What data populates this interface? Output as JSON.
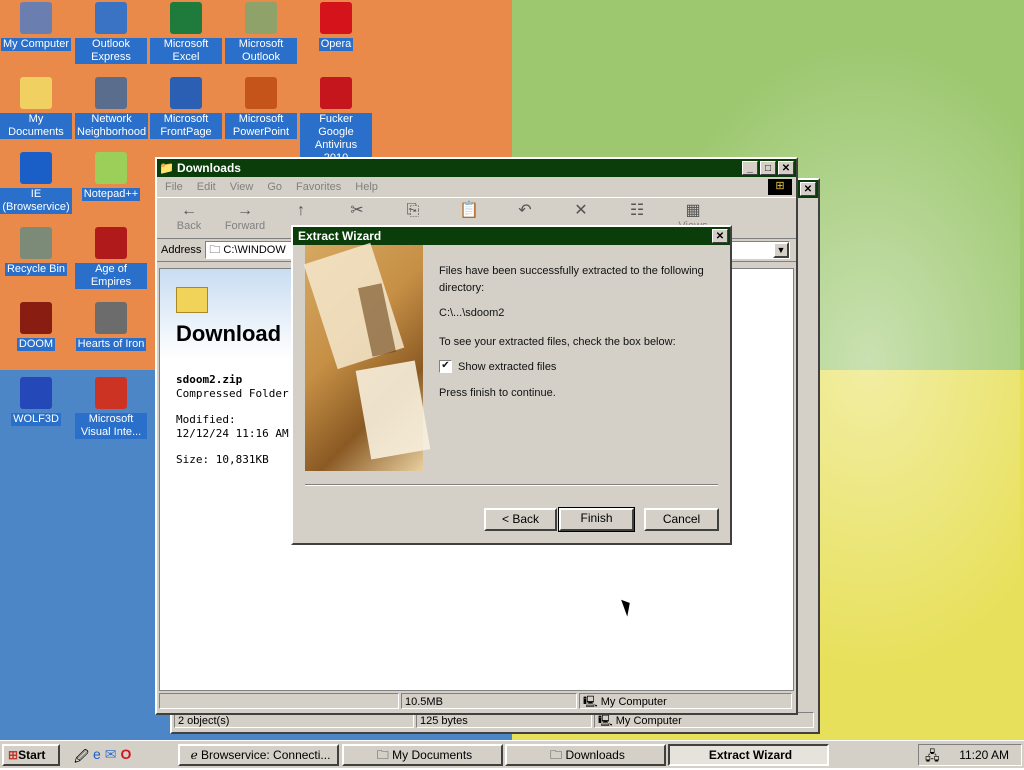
{
  "desktop": {
    "icons": [
      {
        "label": "My Computer",
        "icon": "my-computer-icon",
        "color": "#6a7fb0"
      },
      {
        "label": "Outlook Express",
        "icon": "outlook-express-icon",
        "color": "#3a72c4"
      },
      {
        "label": "Microsoft Excel",
        "icon": "excel-icon",
        "color": "#1e7b3b"
      },
      {
        "label": "Microsoft Outlook",
        "icon": "outlook-icon",
        "color": "#8fa26a"
      },
      {
        "label": "Opera",
        "icon": "opera-icon",
        "color": "#d4131b"
      },
      {
        "label": "My Documents",
        "icon": "my-documents-icon",
        "color": "#f0d060"
      },
      {
        "label": "Network Neighborhood",
        "icon": "network-neighborhood-icon",
        "color": "#5a6d8c"
      },
      {
        "label": "Microsoft FrontPage",
        "icon": "frontpage-icon",
        "color": "#2b5fb4"
      },
      {
        "label": "Microsoft PowerPoint",
        "icon": "powerpoint-icon",
        "color": "#c4541a"
      },
      {
        "label": "Fucker Google Antivirus 2010",
        "icon": "antivirus-icon",
        "color": "#c4161c"
      },
      {
        "label": "IE (Browservice)",
        "icon": "internet-explorer-icon",
        "color": "#1a5fc8"
      },
      {
        "label": "Notepad++",
        "icon": "notepad-plus-icon",
        "color": "#9ccf5a"
      },
      {
        "label": "Recycle Bin",
        "icon": "recycle-bin-icon",
        "color": "#7c8a78"
      },
      {
        "label": "Age of Empires",
        "icon": "age-of-empires-icon",
        "color": "#b01a1a"
      },
      {
        "label": "DOOM",
        "icon": "doom-icon",
        "color": "#8a1d12"
      },
      {
        "label": "Hearts of Iron",
        "icon": "hearts-of-iron-icon",
        "color": "#6c6c6c"
      },
      {
        "label": "WOLF3D",
        "icon": "wolf3d-icon",
        "color": "#2448b8"
      },
      {
        "label": "Microsoft Visual Inte...",
        "icon": "visual-interdev-icon",
        "color": "#cc3322"
      }
    ]
  },
  "explorer": {
    "title": "Downloads",
    "menu": [
      "File",
      "Edit",
      "View",
      "Go",
      "Favorites",
      "Help"
    ],
    "toolbar": [
      {
        "label": "Back",
        "glyph": "←"
      },
      {
        "label": "Forward",
        "glyph": "→"
      },
      {
        "label": "",
        "glyph": "↑"
      },
      {
        "label": "",
        "glyph": "✂"
      },
      {
        "label": "",
        "glyph": "⎘"
      },
      {
        "label": "",
        "glyph": "📋"
      },
      {
        "label": "",
        "glyph": "↶"
      },
      {
        "label": "",
        "glyph": "✕"
      },
      {
        "label": "",
        "glyph": "☷"
      },
      {
        "label": "Views",
        "glyph": "▦"
      }
    ],
    "address_label": "Address",
    "address_value": "C:\\WINDOW",
    "webview": {
      "heading": "Download",
      "file_name": "sdoom2.zip",
      "file_type": "Compressed Folder",
      "modified_label": "Modified:",
      "modified_value": "12/12/24 11:16 AM",
      "size": "Size: 10,831KB"
    },
    "status": {
      "size": "10.5MB",
      "location": "My Computer"
    }
  },
  "back_window": {
    "status": {
      "objects": "2 object(s)",
      "bytes": "125 bytes",
      "location": "My Computer"
    }
  },
  "wizard": {
    "title": "Extract Wizard",
    "line1": "Files have been successfully extracted to the following",
    "line2": "directory:",
    "path": "C:\\...\\sdoom2",
    "instruction": "To see your extracted files, check the box below:",
    "checkbox_label": "Show extracted files",
    "checkbox_checked": true,
    "press_finish": "Press finish to continue.",
    "buttons": {
      "back": "< Back",
      "finish": "Finish",
      "cancel": "Cancel"
    }
  },
  "taskbar": {
    "start": "Start",
    "quicklaunch": [
      "show-desktop-icon",
      "internet-explorer-icon",
      "outlook-express-icon",
      "opera-icon"
    ],
    "tasks": [
      {
        "label": "Browservice: Connecti...",
        "icon": "internet-explorer-icon",
        "active": false
      },
      {
        "label": "My Documents",
        "icon": "folder-icon",
        "active": false
      },
      {
        "label": "Downloads",
        "icon": "folder-icon",
        "active": false
      },
      {
        "label": "Extract Wizard",
        "icon": "",
        "active": true
      }
    ],
    "clock": "11:20 AM"
  },
  "colors": {
    "titlebar": "#0a3d0a",
    "label_bg": "#2a6fc9",
    "face": "#d4d0c8"
  }
}
